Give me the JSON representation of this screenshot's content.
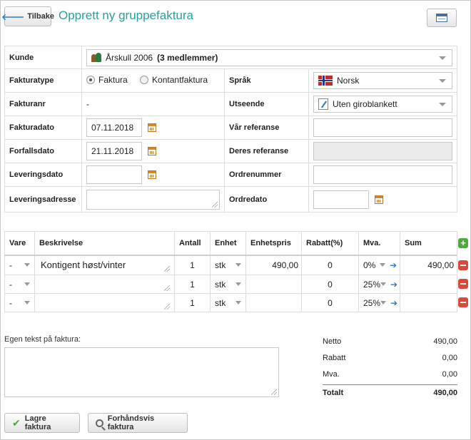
{
  "header": {
    "back_label": "Tilbake",
    "title": "Opprett ny gruppefaktura"
  },
  "form": {
    "customer_label": "Kunde",
    "customer_value_name": "Årskull 2006",
    "customer_value_members": "(3 medlemmer)",
    "invoice_type_label": "Fakturatype",
    "invoice_type_options": [
      "Faktura",
      "Kontantfaktura"
    ],
    "invoice_type_selected": "Faktura",
    "language_label": "Språk",
    "language_value": "Norsk",
    "invoice_no_label": "Fakturanr",
    "invoice_no_value": "-",
    "layout_label": "Utseende",
    "layout_value": "Uten giroblankett",
    "invoice_date_label": "Fakturadato",
    "invoice_date_value": "07.11.2018",
    "our_ref_label": "Vår referanse",
    "our_ref_value": "",
    "due_date_label": "Forfallsdato",
    "due_date_value": "21.11.2018",
    "their_ref_label": "Deres referanse",
    "their_ref_value": "",
    "delivery_date_label": "Leveringsdato",
    "delivery_date_value": "",
    "order_no_label": "Ordrenummer",
    "order_no_value": "",
    "delivery_address_label": "Leveringsadresse",
    "delivery_address_value": "",
    "order_date_label": "Ordredato",
    "order_date_value": ""
  },
  "lines": {
    "columns": [
      "Vare",
      "Beskrivelse",
      "Antall",
      "Enhet",
      "Enhetspris",
      "Rabatt(%)",
      "Mva.",
      "Sum"
    ],
    "rows": [
      {
        "product": "-",
        "description": "Kontigent høst/vinter",
        "qty": "1",
        "unit": "stk",
        "unit_price": "490,00",
        "discount": "0",
        "vat": "0%",
        "sum": "490,00"
      },
      {
        "product": "-",
        "description": "",
        "qty": "1",
        "unit": "stk",
        "unit_price": "",
        "discount": "0",
        "vat": "25%",
        "sum": ""
      },
      {
        "product": "-",
        "description": "",
        "qty": "1",
        "unit": "stk",
        "unit_price": "",
        "discount": "0",
        "vat": "25%",
        "sum": ""
      }
    ]
  },
  "note": {
    "label": "Egen tekst på faktura:",
    "value": ""
  },
  "totals": {
    "net_label": "Netto",
    "net_value": "490,00",
    "discount_label": "Rabatt",
    "discount_value": "0,00",
    "vat_label": "Mva.",
    "vat_value": "0,00",
    "total_label": "Totalt",
    "total_value": "490,00"
  },
  "actions": {
    "save_label": "Lagre faktura",
    "preview_label": "Forhåndsvis faktura"
  },
  "icons": {
    "add_row": "plus-icon",
    "remove_row": "minus-icon",
    "calendar": "calendar-icon",
    "back": "arrow-left-icon",
    "view": "window-icon"
  },
  "colors": {
    "title": "#2aa19a",
    "add": "#4fa83d",
    "remove": "#d84a3a",
    "link": "#2e7ec2"
  }
}
